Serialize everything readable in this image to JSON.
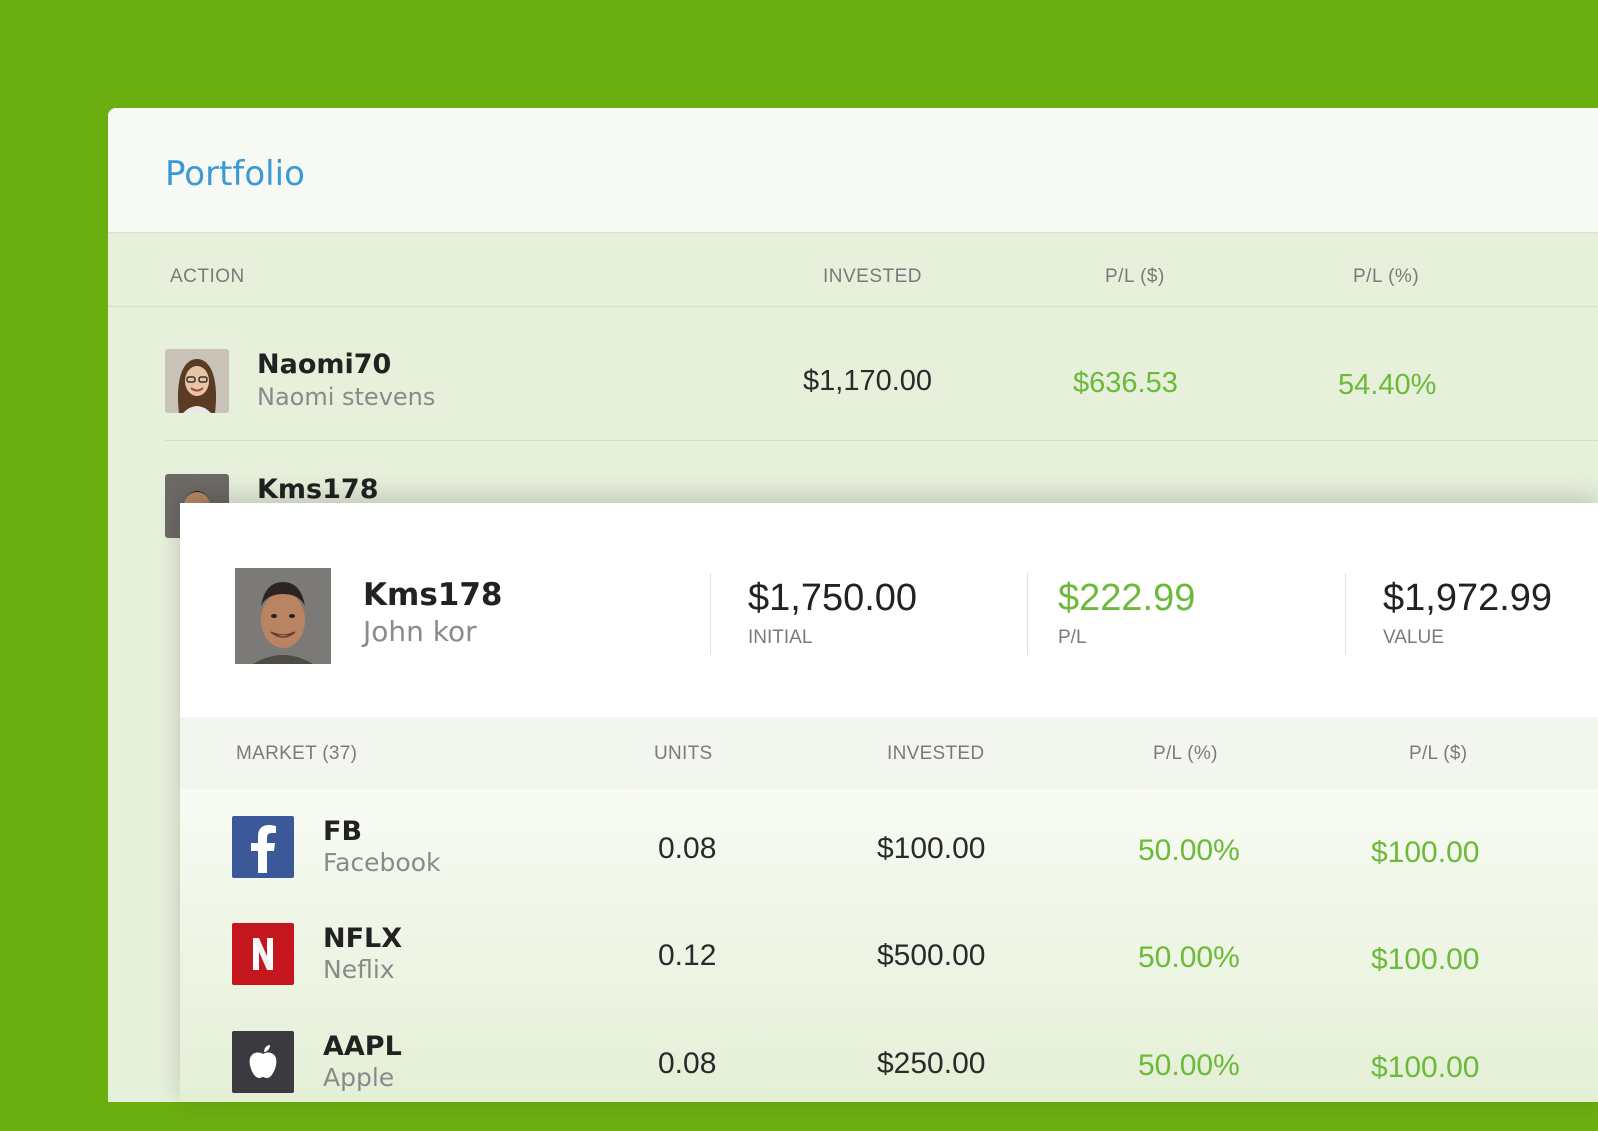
{
  "portfolio": {
    "title": "Portfolio",
    "columns": {
      "action": "ACTION",
      "invested": "INVESTED",
      "pl_usd": "P/L ($)",
      "pl_pct": "P/L (%)"
    },
    "rows": [
      {
        "username": "Naomi70",
        "fullname": "Naomi stevens",
        "invested": "$1,170.00",
        "pl_usd": "$636.53",
        "pl_pct": "54.40%"
      },
      {
        "username": "Kms178",
        "fullname": "",
        "invested": "",
        "pl_usd": "",
        "pl_pct": ""
      }
    ]
  },
  "detail": {
    "username": "Kms178",
    "fullname": "John kor",
    "initial_value": "$1,750.00",
    "initial_label": "INITIAL",
    "pl_value": "$222.99",
    "pl_label": "P/L",
    "total_value": "$1,972.99",
    "total_label": "VALUE",
    "columns": {
      "market": "MARKET (37)",
      "units": "UNITS",
      "invested": "INVESTED",
      "pl_pct": "P/L (%)",
      "pl_usd": "P/L ($)"
    },
    "markets": [
      {
        "ticker": "FB",
        "name": "Facebook",
        "units": "0.08",
        "invested": "$100.00",
        "pl_pct": "50.00%",
        "pl_usd": "$100.00",
        "logo_icon": "facebook-icon",
        "logo_color": "#3b5998"
      },
      {
        "ticker": "NFLX",
        "name": "Neflix",
        "units": "0.12",
        "invested": "$500.00",
        "pl_pct": "50.00%",
        "pl_usd": "$100.00",
        "logo_icon": "netflix-icon",
        "logo_color": "#c4161c"
      },
      {
        "ticker": "AAPL",
        "name": "Apple",
        "units": "0.08",
        "invested": "$250.00",
        "pl_pct": "50.00%",
        "pl_usd": "$100.00",
        "logo_icon": "apple-icon",
        "logo_color": "#3a3a40"
      }
    ]
  },
  "colors": {
    "background": "#6aae10",
    "accent_blue": "#3b9ad4",
    "positive_green": "#6cba3a"
  }
}
